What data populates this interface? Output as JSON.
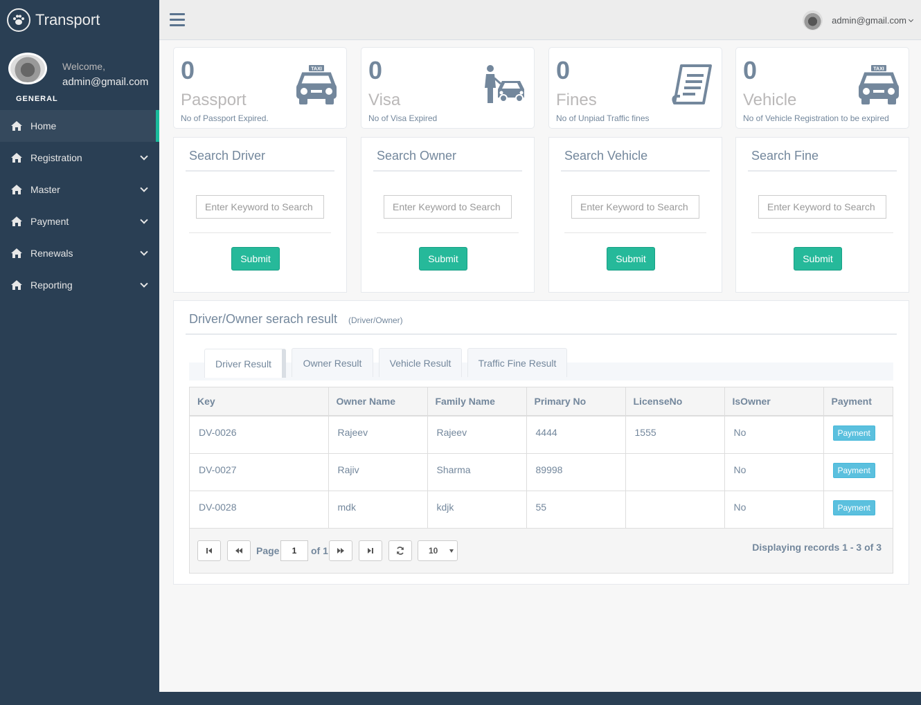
{
  "app": {
    "title": "Transport",
    "welcome": "Welcome,",
    "user_email": "admin@gmail.com",
    "section": "GENERAL"
  },
  "sidebar": {
    "items": [
      {
        "label": "Home",
        "icon": "home-icon",
        "active": true
      },
      {
        "label": "Registration",
        "icon": "home-icon",
        "has_submenu": true
      },
      {
        "label": "Master",
        "icon": "home-icon",
        "has_submenu": true
      },
      {
        "label": "Payment",
        "icon": "home-icon",
        "has_submenu": true
      },
      {
        "label": "Renewals",
        "icon": "home-icon",
        "has_submenu": true
      },
      {
        "label": "Reporting",
        "icon": "home-icon",
        "has_submenu": true
      }
    ]
  },
  "topbar": {
    "user_label": "admin@gmail.com"
  },
  "tiles": [
    {
      "count": "0",
      "label": "Passport",
      "desc": "No of Passport Expired.",
      "icon": "taxi-icon"
    },
    {
      "count": "0",
      "label": "Visa",
      "desc": "No of Visa Expired",
      "icon": "driver-car-icon"
    },
    {
      "count": "0",
      "label": "Fines",
      "desc": "No of Unpiad Traffic fines",
      "icon": "receipt-icon"
    },
    {
      "count": "0",
      "label": "Vehicle",
      "desc": "No of Vehicle Registration to be expired",
      "icon": "taxi-icon"
    }
  ],
  "search_panels": [
    {
      "title": "Search Driver",
      "placeholder": "Enter Keyword to Search",
      "submit": "Submit"
    },
    {
      "title": "Search Owner",
      "placeholder": "Enter Keyword to Search",
      "submit": "Submit"
    },
    {
      "title": "Search Vehicle",
      "placeholder": "Enter Keyword to Search",
      "submit": "Submit"
    },
    {
      "title": "Search Fine",
      "placeholder": "Enter Keyword to Search",
      "submit": "Submit"
    }
  ],
  "results": {
    "title": "Driver/Owner serach result",
    "subtitle": "(Driver/Owner)",
    "tabs": [
      "Driver Result",
      "Owner Result",
      "Vehicle Result",
      "Traffic Fine Result"
    ],
    "columns": [
      "Key",
      "Owner Name",
      "Family Name",
      "Primary No",
      "LicenseNo",
      "IsOwner",
      "Payment"
    ],
    "rows": [
      {
        "key": "DV-0026",
        "owner_name": "Rajeev",
        "family_name": "Rajeev",
        "primary_no": "4444",
        "license_no": "1555",
        "is_owner": "No",
        "payment": "Payment"
      },
      {
        "key": "DV-0027",
        "owner_name": "Rajiv",
        "family_name": "Sharma",
        "primary_no": "89998",
        "license_no": "",
        "is_owner": "No",
        "payment": "Payment"
      },
      {
        "key": "DV-0028",
        "owner_name": "mdk",
        "family_name": "kdjk",
        "primary_no": "55",
        "license_no": "",
        "is_owner": "No",
        "payment": "Payment"
      }
    ],
    "pager": {
      "page_label": "Page",
      "page_value": "1",
      "of_label": "of 1",
      "page_size": "10",
      "records": "Displaying records 1 - 3 of 3"
    }
  },
  "colors": {
    "sidebar": "#2a3f54",
    "accent": "#1abb9c",
    "submit": "#26b99a",
    "payment": "#5bc0de"
  }
}
